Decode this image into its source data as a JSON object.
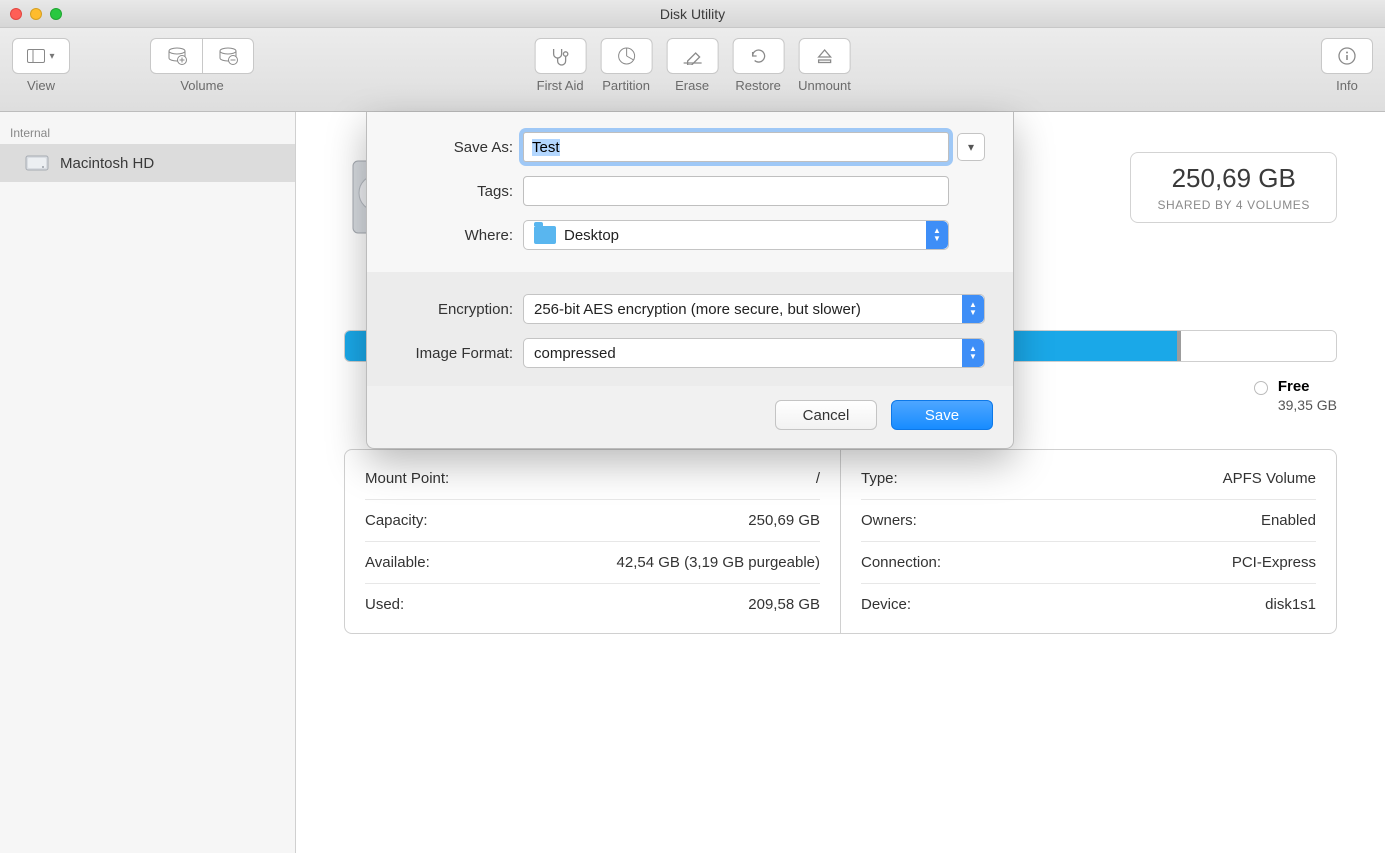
{
  "window": {
    "title": "Disk Utility"
  },
  "toolbar": {
    "view": "View",
    "volume": "Volume",
    "first_aid": "First Aid",
    "partition": "Partition",
    "erase": "Erase",
    "restore": "Restore",
    "unmount": "Unmount",
    "info": "Info"
  },
  "sidebar": {
    "section": "Internal",
    "items": [
      {
        "label": "Macintosh HD",
        "selected": true
      }
    ]
  },
  "volume": {
    "size": "250,69 GB",
    "shared": "SHARED BY 4 VOLUMES"
  },
  "legend": {
    "free_label": "Free",
    "free_value": "39,35 GB"
  },
  "props_left": [
    {
      "k": "Mount Point:",
      "v": "/"
    },
    {
      "k": "Capacity:",
      "v": "250,69 GB"
    },
    {
      "k": "Available:",
      "v": "42,54 GB (3,19 GB purgeable)"
    },
    {
      "k": "Used:",
      "v": "209,58 GB"
    }
  ],
  "props_right": [
    {
      "k": "Type:",
      "v": "APFS Volume"
    },
    {
      "k": "Owners:",
      "v": "Enabled"
    },
    {
      "k": "Connection:",
      "v": "PCI-Express"
    },
    {
      "k": "Device:",
      "v": "disk1s1"
    }
  ],
  "sheet": {
    "save_as_label": "Save As:",
    "save_as_value": "Test",
    "tags_label": "Tags:",
    "tags_value": "",
    "where_label": "Where:",
    "where_value": "Desktop",
    "encryption_label": "Encryption:",
    "encryption_value": "256-bit AES encryption (more secure, but slower)",
    "format_label": "Image Format:",
    "format_value": "compressed",
    "cancel": "Cancel",
    "save": "Save"
  }
}
